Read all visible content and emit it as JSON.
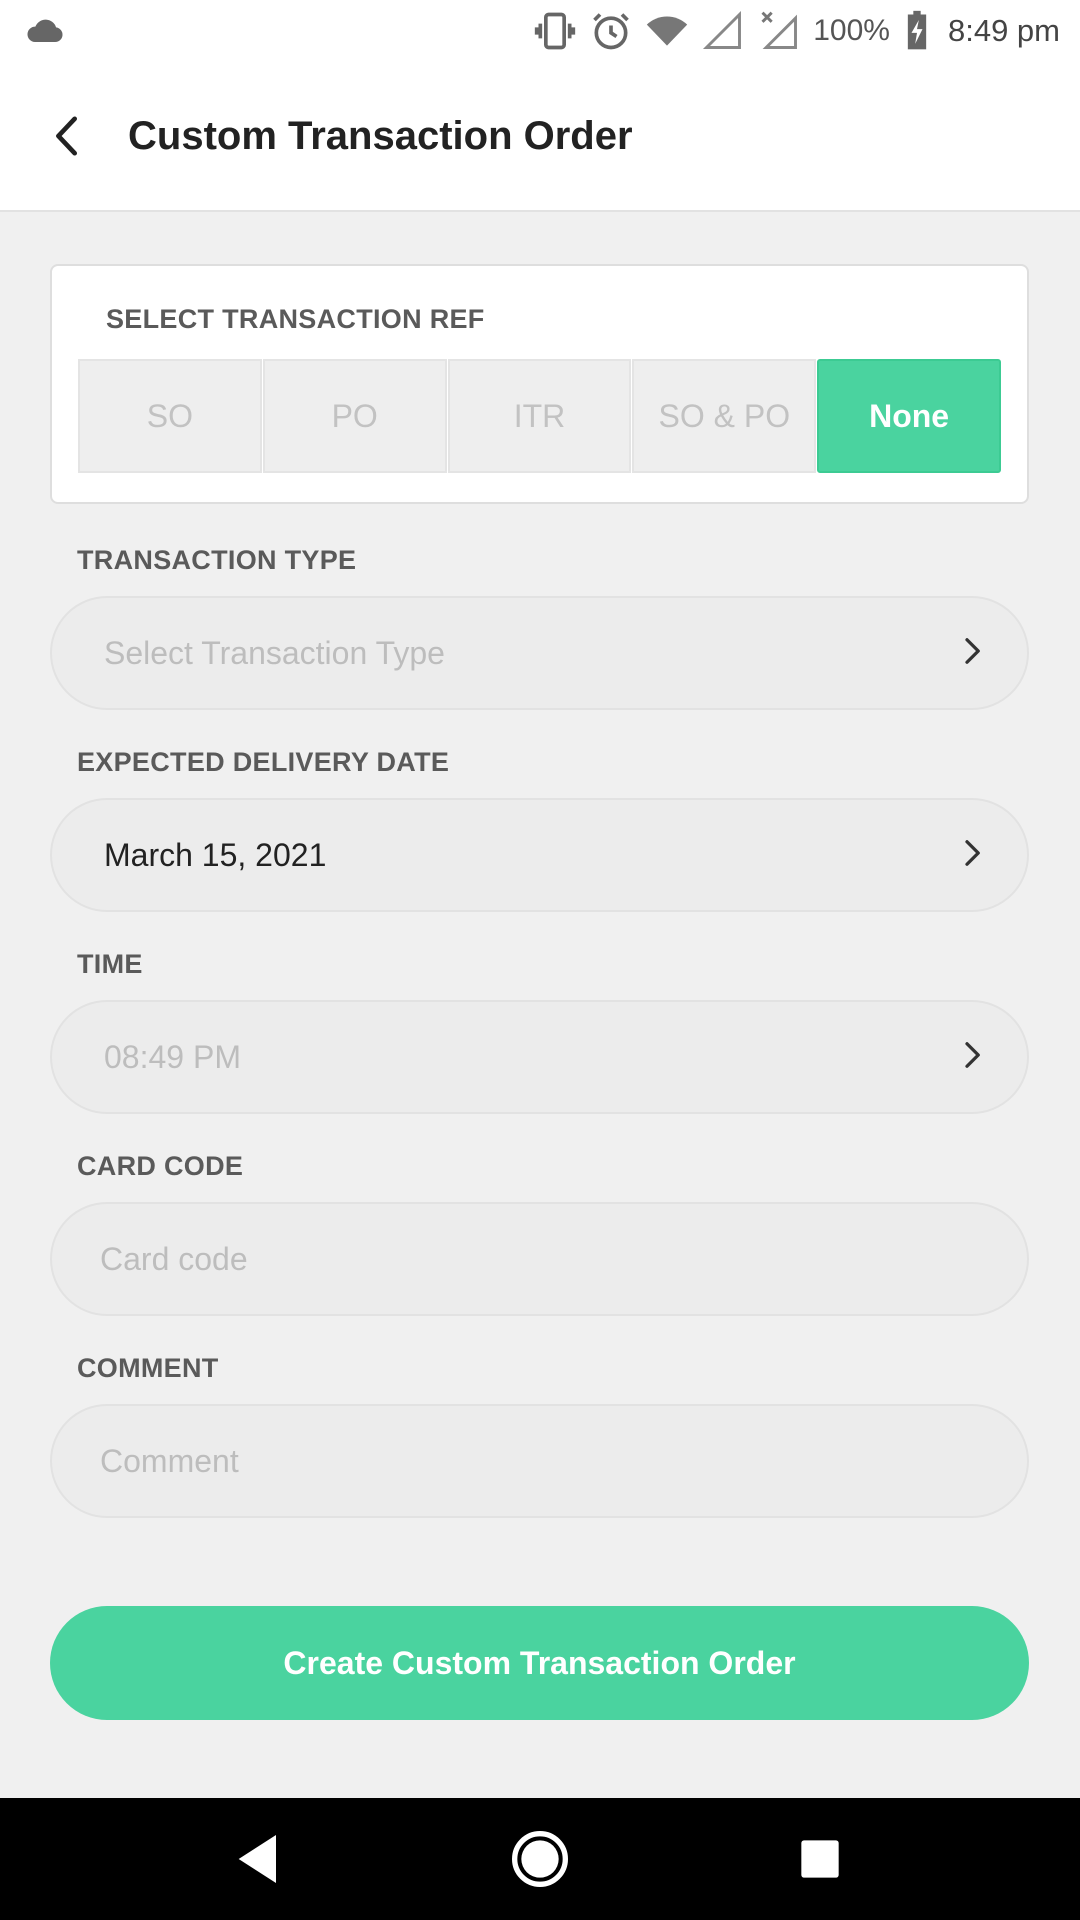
{
  "status_bar": {
    "left_icon": "cloud-icon",
    "icons": [
      "vibrate-icon",
      "alarm-icon",
      "wifi-icon",
      "signal-icon",
      "signal-off-icon",
      "battery-charging-icon"
    ],
    "battery": "100%",
    "time": "8:49 pm"
  },
  "app_bar": {
    "back_icon": "chevron-left-icon",
    "title": "Custom Transaction Order"
  },
  "transaction_ref": {
    "title": "SELECT TRANSACTION REF",
    "options": [
      "SO",
      "PO",
      "ITR",
      "SO & PO",
      "None"
    ],
    "selected": "None"
  },
  "fields": {
    "transaction_type": {
      "label": "TRANSACTION TYPE",
      "placeholder": "Select Transaction Type"
    },
    "delivery_date": {
      "label": "EXPECTED DELIVERY DATE",
      "value": "March 15, 2021"
    },
    "time": {
      "label": "TIME",
      "value": "08:49 PM"
    },
    "card_code": {
      "label": "CARD CODE",
      "placeholder": "Card code"
    },
    "comment": {
      "label": "COMMENT",
      "placeholder": "Comment"
    }
  },
  "submit": {
    "label": "Create Custom Transaction Order"
  },
  "nav_bar": {
    "icons": [
      "nav-back-icon",
      "nav-home-icon",
      "nav-recents-icon"
    ]
  },
  "colors": {
    "accent": "#4ad39f",
    "background": "#f0f0f0",
    "field_bg": "#ececec"
  }
}
